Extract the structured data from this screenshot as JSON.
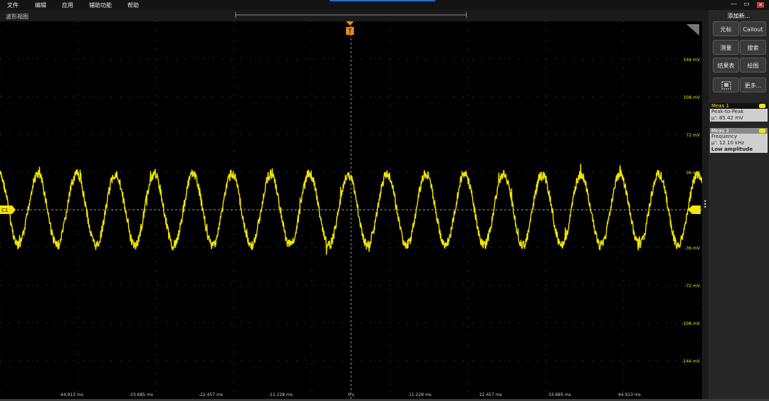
{
  "menu": [
    "文件",
    "编辑",
    "应用",
    "辅助功能",
    "帮助"
  ],
  "window_controls": {
    "minimize": "—",
    "restore": "▭",
    "close": "✕"
  },
  "waveform_view": {
    "title": "波形视图"
  },
  "panel": {
    "title": "添加新...",
    "buttons": [
      {
        "label": "光标"
      },
      {
        "label": "Callout"
      },
      {
        "label": "测量"
      },
      {
        "label": "搜索"
      },
      {
        "label": "结果表"
      },
      {
        "label": "绘图"
      },
      {
        "icon": "zoom-icon"
      },
      {
        "label": "更多..."
      }
    ]
  },
  "meas1": {
    "title": "Meas 1",
    "name": "Peak-to-Peak",
    "value": "μ': 85.42 mV"
  },
  "meas2": {
    "title": "Meas 2",
    "name": "Frequency",
    "value": "μ': 12.10 kHz",
    "note": "Low amplitude"
  },
  "chart_data": {
    "type": "line",
    "series": [
      {
        "name": "C1",
        "waveform": "sine",
        "frequency_khz": 12.1,
        "peak_to_peak_mv": 85.42,
        "offset_mv": 0,
        "color": "#f3e600"
      }
    ],
    "trigger_marker": "T",
    "channel_label": "C1",
    "x_tick_labels": [
      "-44.913 ms",
      "-33.685 ms",
      "-22.457 ms",
      "-11.228 ms",
      "0 s",
      "11.228 ms",
      "22.457 ms",
      "33.685 ms",
      "44.913 ms"
    ],
    "y_tick_labels": [
      "144 mV",
      "108 mV",
      "72 mV",
      "36 mV",
      "-36 mV",
      "-72 mV",
      "-108 mV",
      "-144 mV"
    ],
    "ylim_mv": [
      -180,
      180
    ],
    "grid": true
  },
  "colors": {
    "trace": "#f3e600",
    "trigger": "#f08a1c",
    "grid": "#555555",
    "accent": "#1e6fd0"
  }
}
